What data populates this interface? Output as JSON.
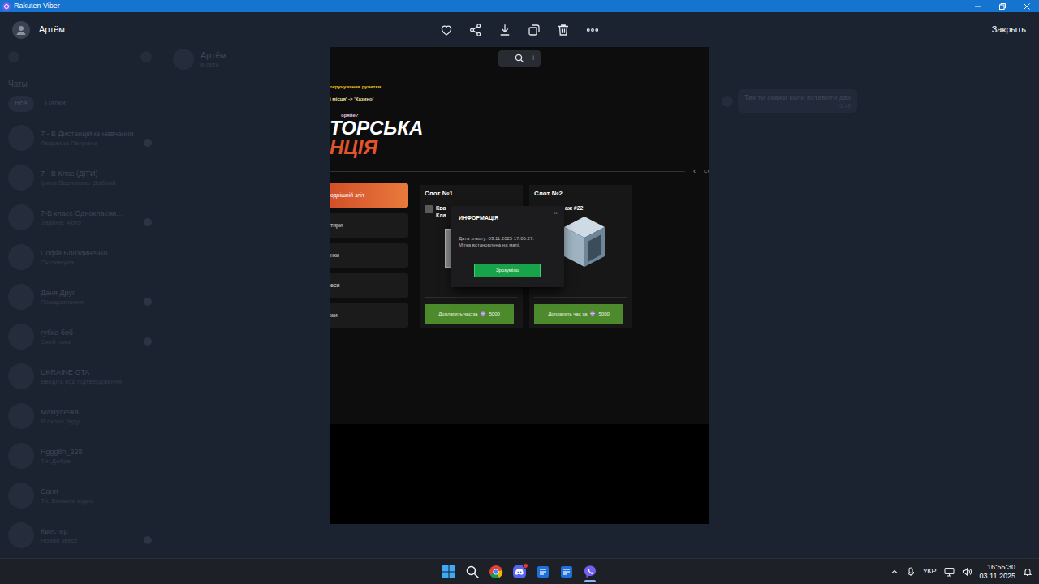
{
  "window": {
    "title": "Rakuten Viber"
  },
  "viewer": {
    "sender": "Артём",
    "close": "Закрыть",
    "zoom": {
      "minus": "−",
      "plus": "+"
    }
  },
  "sidebar": {
    "header": "Чаты",
    "filters": [
      {
        "label": "Все",
        "selected": true
      },
      {
        "label": "Папки",
        "selected": false
      }
    ],
    "chats": [
      {
        "name": "7 - В Дистанційне навчання",
        "preview": "Людмила Петрівна",
        "unread": true
      },
      {
        "name": "7 - В Клас (ДІТИ)",
        "preview": "Ірина Василівна: Добрий",
        "unread": false
      },
      {
        "name": "7-В класс Однокласни...",
        "preview": "Зарина: Фото",
        "unread": true
      },
      {
        "name": "Софія Блоздиненко",
        "preview": "Ок скинула",
        "unread": false
      },
      {
        "name": "Даня Друг",
        "preview": "Повідомлення",
        "unread": true
      },
      {
        "name": "губка боб",
        "preview": "Окей пока",
        "unread": true
      },
      {
        "name": "UKRAINE GTA",
        "preview": "Введіть код підтвердження",
        "unread": false
      },
      {
        "name": "Мамулечка",
        "preview": "Я скоро буду",
        "unread": false
      },
      {
        "name": "Hggg8h_228",
        "preview": "Ти: Добре",
        "unread": false
      },
      {
        "name": "Саня",
        "preview": "Ти: Ввімкни відео",
        "unread": false
      },
      {
        "name": "Квестер",
        "preview": "Новий квест",
        "unread": true
      }
    ]
  },
  "conversation": {
    "name": "Артём",
    "status": "в сети",
    "message": {
      "text": "Так ти скажи коли вставити дах",
      "time": "16:48"
    }
  },
  "game": {
    "notices": [
      "окручування рулетки",
      "і місця' -> 'Казино'"
    ],
    "tag": "оряйе?",
    "title": [
      "ТОРСЬКА",
      "НЦІЯ"
    ],
    "arrow": "‹",
    "edge_label": "Ст",
    "menu": [
      {
        "label": "однішній зліт",
        "selected": true
      },
      {
        "label": "тири",
        "selected": false
      },
      {
        "label": "нки",
        "selected": false
      },
      {
        "label": "еси",
        "selected": false
      },
      {
        "label": "жи",
        "selected": false
      }
    ],
    "slots": [
      {
        "title": "Слот №1",
        "kind": "building",
        "lines": [
          "Ква",
          "Кла"
        ],
        "button": {
          "label": "Доплатить час за",
          "price": "5000"
        }
      },
      {
        "title": "Слот №2",
        "kind": "garage",
        "lines": [
          "аж #22"
        ],
        "button": {
          "label": "Доплатить час за",
          "price": "5000"
        }
      }
    ],
    "modal": {
      "title": "ИНФОРМАЦІЯ",
      "close": "×",
      "lines": [
        "Дата зльоту: 03.11.2025 17:06:27.",
        "Мітка встановлена на мапі."
      ],
      "button": "Зрозуміло"
    }
  },
  "taskbar": {
    "apps": [
      {
        "kind": "windows",
        "active": false,
        "badge": false
      },
      {
        "kind": "search",
        "active": false,
        "badge": false
      },
      {
        "kind": "chrome",
        "active": false,
        "badge": false
      },
      {
        "kind": "discord",
        "active": false,
        "badge": true
      },
      {
        "kind": "app",
        "active": false,
        "badge": false
      },
      {
        "kind": "app",
        "active": false,
        "badge": false
      },
      {
        "kind": "viber",
        "active": true,
        "badge": false
      }
    ],
    "language": "УКР",
    "time": "16:55:30",
    "date": "03.11.2025"
  }
}
